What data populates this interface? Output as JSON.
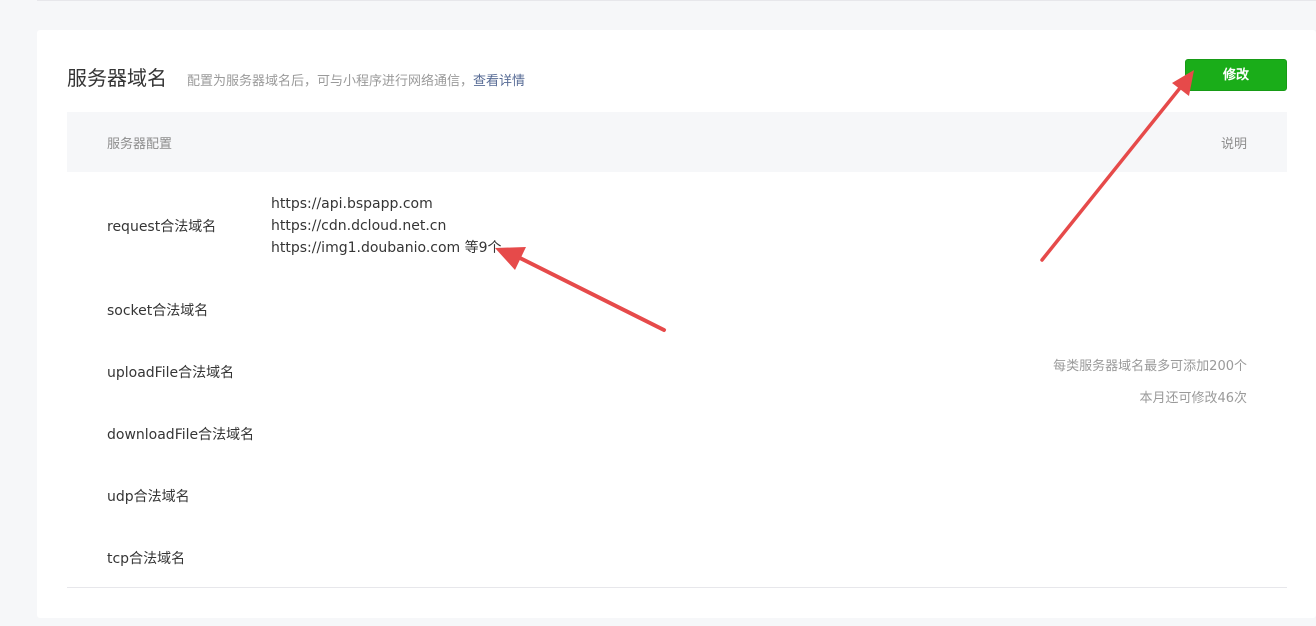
{
  "section": {
    "title": "服务器域名",
    "description": "配置为服务器域名后，可与小程序进行网络通信，",
    "detail_link": "查看详情",
    "edit_button": "修改"
  },
  "table": {
    "col_config": "服务器配置",
    "col_note": "说明"
  },
  "rows": [
    {
      "label": "request合法域名"
    },
    {
      "label": "socket合法域名"
    },
    {
      "label": "uploadFile合法域名"
    },
    {
      "label": "downloadFile合法域名"
    },
    {
      "label": "udp合法域名"
    },
    {
      "label": "tcp合法域名"
    }
  ],
  "request_domains": [
    "https://api.bspapp.com",
    "https://cdn.dcloud.net.cn",
    "https://img1.doubanio.com 等9个"
  ],
  "notes": [
    "每类服务器域名最多可添加200个",
    "本月还可修改46次"
  ],
  "colors": {
    "accent_green": "#1aad19",
    "link_blue": "#576b95",
    "arrow_red": "#e64a4a"
  }
}
